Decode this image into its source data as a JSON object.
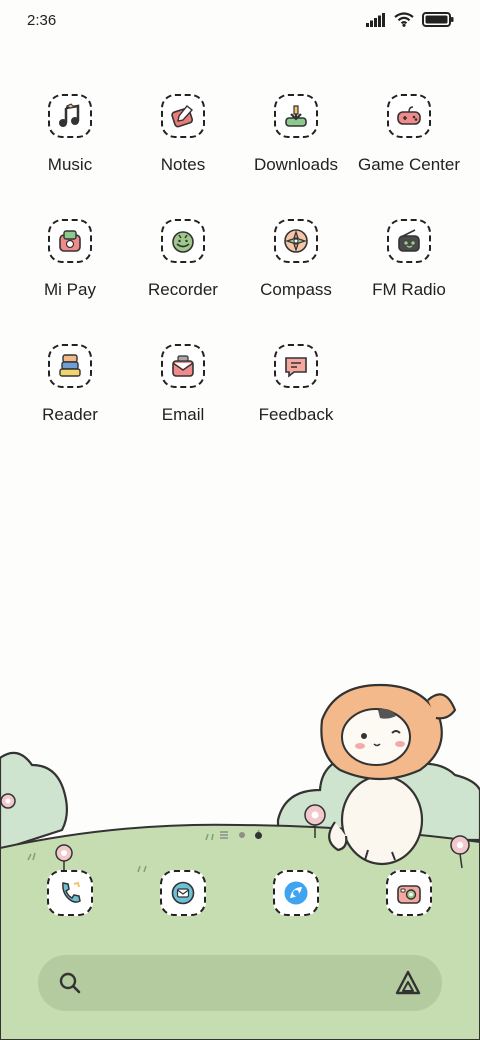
{
  "status_bar": {
    "time": "2:36"
  },
  "apps": [
    {
      "label": "Music",
      "icon": "music-icon"
    },
    {
      "label": "Notes",
      "icon": "notes-icon"
    },
    {
      "label": "Downloads",
      "icon": "downloads-icon"
    },
    {
      "label": "Game Center",
      "icon": "game-controller-icon"
    },
    {
      "label": "Mi Pay",
      "icon": "wallet-icon"
    },
    {
      "label": "Recorder",
      "icon": "recorder-icon"
    },
    {
      "label": "Compass",
      "icon": "compass-icon"
    },
    {
      "label": "FM Radio",
      "icon": "radio-icon"
    },
    {
      "label": "Reader",
      "icon": "reader-icon"
    },
    {
      "label": "Email",
      "icon": "email-icon"
    },
    {
      "label": "Feedback",
      "icon": "feedback-icon"
    }
  ],
  "dock": [
    {
      "icon": "phone-icon"
    },
    {
      "icon": "messages-icon"
    },
    {
      "icon": "browser-icon"
    },
    {
      "icon": "camera-icon"
    }
  ],
  "page_indicator": {
    "pages": 2,
    "active": 2
  },
  "colors": {
    "grass": "#c5ddb0",
    "bush": "#cfe4cf",
    "accent_orange": "#f4b98a",
    "pink": "#f08b8b"
  }
}
